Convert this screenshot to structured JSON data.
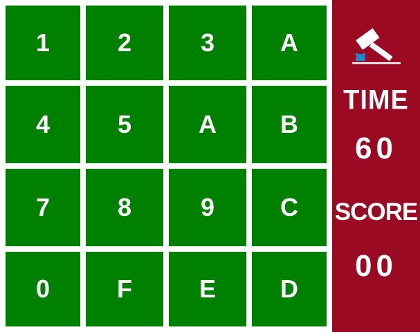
{
  "tiles": [
    [
      "1",
      "2",
      "3",
      "A"
    ],
    [
      "4",
      "5",
      "A",
      "B"
    ],
    [
      "7",
      "8",
      "9",
      "C"
    ],
    [
      "0",
      "F",
      "E",
      "D"
    ]
  ],
  "panel": {
    "icon": "gavel-icon",
    "time_label": "TIME",
    "time_value": "60",
    "score_label": "SCORE",
    "score_value": "00"
  },
  "colors": {
    "tile": "#008000",
    "panel": "#9a0a22",
    "text": "#ffffff",
    "icon_accent": "#1e88c8"
  }
}
